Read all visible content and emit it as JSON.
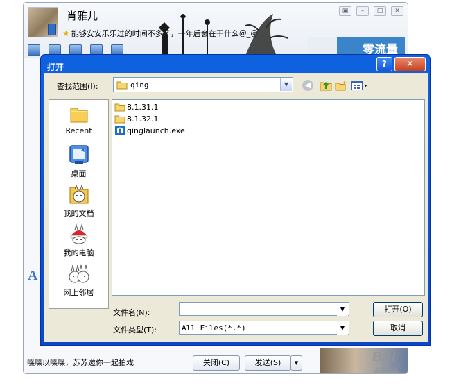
{
  "chat": {
    "name": "肖雅儿",
    "status_message": "能够安安乐乐过的时间不多了，一年后会在干什么＠_＠",
    "ad_text": "零流量",
    "side_letter": "A",
    "message": "喋喋以喋喋，苏苏邀你一起拍戏",
    "close_label": "关闭(C)",
    "send_label": "发送(S)",
    "watermark": "Bai 经验"
  },
  "dialog": {
    "title": "打开",
    "help_label": "?",
    "close_label": "✕",
    "look_in_label": "查找范围(I):",
    "look_in_value": "qing",
    "places": [
      {
        "label": "Recent",
        "icon": "recent-folder-icon"
      },
      {
        "label": "桌面",
        "icon": "desktop-icon"
      },
      {
        "label": "我的文档",
        "icon": "my-documents-icon"
      },
      {
        "label": "我的电脑",
        "icon": "my-computer-icon"
      },
      {
        "label": "网上邻居",
        "icon": "network-icon"
      }
    ],
    "files": [
      {
        "name": "8.1.31.1",
        "icon": "folder-icon"
      },
      {
        "name": "8.1.32.1",
        "icon": "folder-icon"
      },
      {
        "name": "qinglaunch.exe",
        "icon": "exe-icon"
      }
    ],
    "file_name_label": "文件名(N):",
    "file_name_value": "",
    "file_type_label": "文件类型(T):",
    "file_type_value": "All Files(*.*)",
    "open_label": "打开(O)",
    "cancel_label": "取消"
  },
  "colors": {
    "titlebar": "#0a48c8",
    "dialog_face": "#ece9d8",
    "accent_blue": "#3a84c9"
  }
}
